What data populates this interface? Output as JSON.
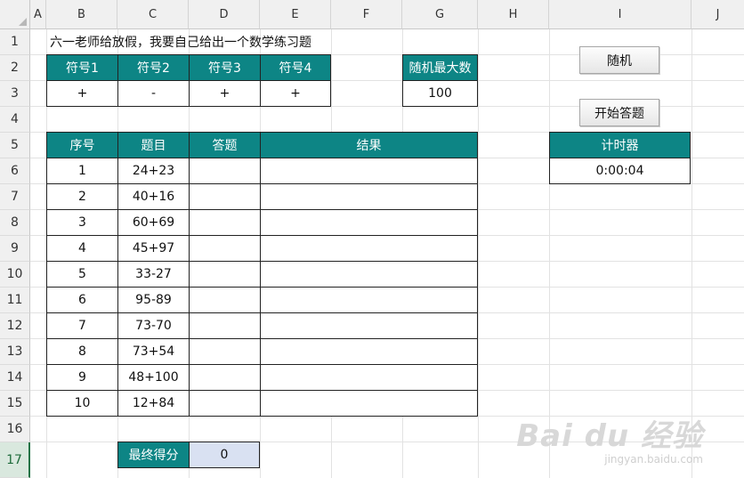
{
  "columns": [
    "A",
    "B",
    "C",
    "D",
    "E",
    "F",
    "G",
    "H",
    "I",
    "J"
  ],
  "rows": [
    "1",
    "2",
    "3",
    "4",
    "5",
    "6",
    "7",
    "8",
    "9",
    "10",
    "11",
    "12",
    "13",
    "14",
    "15",
    "16",
    "17"
  ],
  "active_row": "17",
  "title": "六一老师给放假，我要自己给出一个数学练习题",
  "symbols": {
    "headers": [
      "符号1",
      "符号2",
      "符号3",
      "符号4"
    ],
    "values": [
      "+",
      "-",
      "+",
      "+"
    ]
  },
  "random_max": {
    "label": "随机最大数",
    "value": "100"
  },
  "buttons": {
    "random": "随机",
    "start": "开始答题"
  },
  "timer": {
    "label": "计时器",
    "value": "0:00:04"
  },
  "quiz": {
    "headers": [
      "序号",
      "题目",
      "答题",
      "结果"
    ],
    "rows": [
      {
        "no": "1",
        "question": "24+23",
        "answer": "",
        "result": ""
      },
      {
        "no": "2",
        "question": "40+16",
        "answer": "",
        "result": ""
      },
      {
        "no": "3",
        "question": "60+69",
        "answer": "",
        "result": ""
      },
      {
        "no": "4",
        "question": "45+97",
        "answer": "",
        "result": ""
      },
      {
        "no": "5",
        "question": "33-27",
        "answer": "",
        "result": ""
      },
      {
        "no": "6",
        "question": "95-89",
        "answer": "",
        "result": ""
      },
      {
        "no": "7",
        "question": "73-70",
        "answer": "",
        "result": ""
      },
      {
        "no": "8",
        "question": "73+54",
        "answer": "",
        "result": ""
      },
      {
        "no": "9",
        "question": "48+100",
        "answer": "",
        "result": ""
      },
      {
        "no": "10",
        "question": "12+84",
        "answer": "",
        "result": ""
      }
    ]
  },
  "final_score": {
    "label": "最终得分",
    "value": "0"
  },
  "watermark": {
    "main": "Bai du 经验",
    "sub": "jingyan.baidu.com"
  },
  "colors": {
    "header_teal": "#0d8585",
    "score_fill": "#d9e1f2",
    "active_row": "#217346"
  }
}
